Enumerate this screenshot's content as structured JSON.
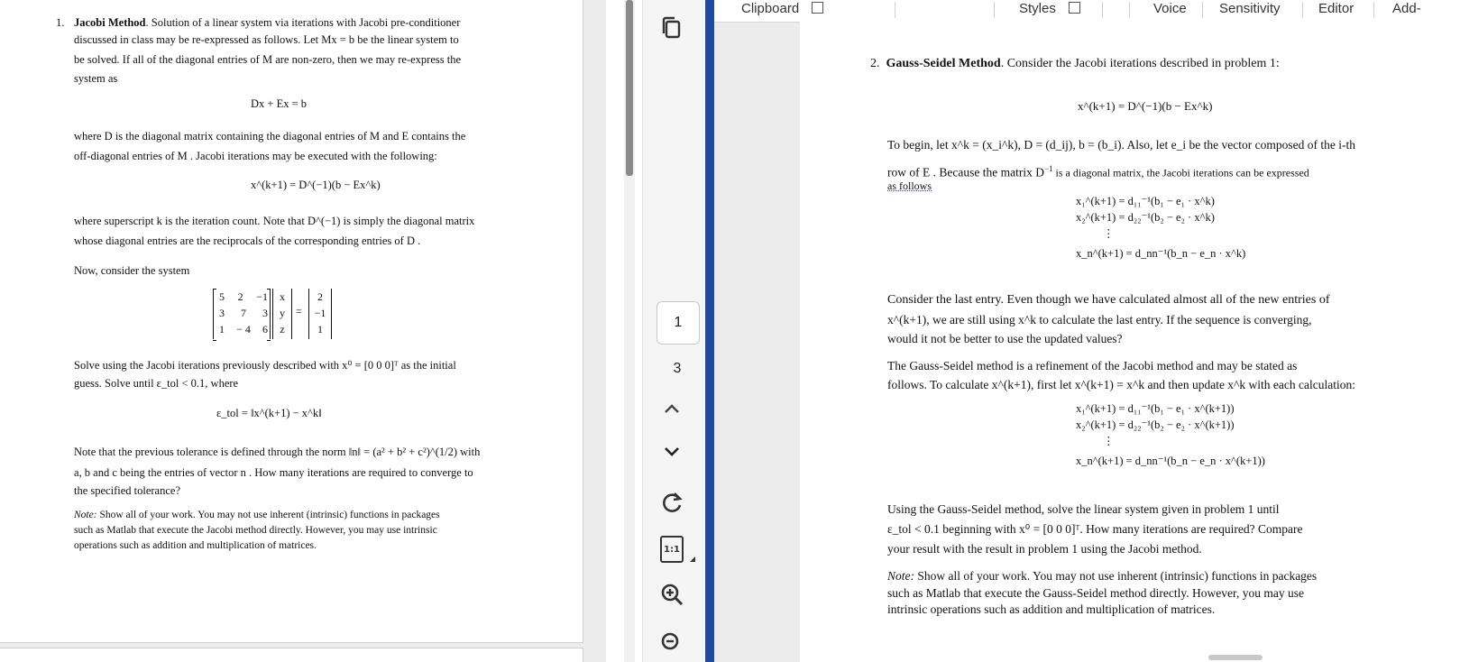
{
  "left_doc": {
    "p1_num": "1.",
    "p1_title": "Jacobi Method",
    "p1_line1": ". Solution of a linear system via iterations with Jacobi pre-conditioner",
    "p1_line2": "discussed in class may be re-expressed as follows. Let  Mx = b  be the linear system to",
    "p1_line3": "be solved. If all of the diagonal entries of  M  are non-zero, then we may re-express the",
    "p1_line4": "system as",
    "eq1": "Dx + Ex = b",
    "p2_line1": "where  D  is the diagonal matrix containing the diagonal entries of  M  and  E contains the",
    "p2_line2": "off-diagonal entries of  M . Jacobi iterations may be executed with the following:",
    "eq2": "x^(k+1) = D^(−1)(b − Ex^k)",
    "p3_line1": "where superscript k is the iteration count. Note that  D^(−1)  is simply the diagonal matrix",
    "p3_line2": "whose diagonal entries are the reciprocals of the corresponding entries of  D .",
    "p4": "Now, consider the system",
    "matrix_rows": [
      [
        "5",
        "2",
        "−1"
      ],
      [
        "3",
        "7",
        "3"
      ],
      [
        "1",
        "− 4",
        "6"
      ]
    ],
    "vector_x": [
      "x",
      "y",
      "z"
    ],
    "vector_b": [
      "2",
      "−1",
      "1"
    ],
    "p5_line1": "Solve using the Jacobi iterations previously described with  x⁰ = [0  0  0]ᵀ  as the initial",
    "p5_line2": "guess. Solve until  ε_tol < 0.1, where",
    "eq3": "ε_tol = ‖x^(k+1) − x^k‖",
    "p6_line1": "Note that the previous tolerance is defined through the norm  ‖n‖ = (a² + b² + c²)^(1/2)  with",
    "p6_line2": "a, b and c being the entries of vector  n . How many iterations are required to converge to",
    "p6_line3": "the specified tolerance?",
    "note_label": "Note:",
    "note_line1": " Show all of your work. You may not use inherent (intrinsic) functions in packages",
    "note_line2": "such as Matlab that execute the Jacobi method directly. However, you may use intrinsic",
    "note_line3": "operations such as addition and multiplication of matrices."
  },
  "toolbar": {
    "current_page": "1",
    "total_pages": "3",
    "icons": [
      "copy-icon",
      "chevron-up-icon",
      "chevron-down-icon",
      "refresh-icon",
      "actual-size-icon",
      "zoom-in-icon",
      "zoom-out-icon"
    ],
    "actual_size_label": "1:1"
  },
  "ribbon": {
    "clipboard": "Clipboard",
    "styles": "Styles",
    "voice": "Voice",
    "sensitivity": "Sensitivity",
    "editor": "Editor",
    "addins": "Add-"
  },
  "right_doc": {
    "q2_num": "2.",
    "q2_title": "Gauss-Seidel Method",
    "q2_intro": ". Consider the Jacobi iterations described in problem 1:",
    "eq1": "x^(k+1) = D^(−1)(b − Ex^k)",
    "p1_line1": "To begin, let  x^k = (x_i^k),  D = (d_ij),  b = (b_i). Also, let  e_i  be the vector composed of the i-th",
    "p1_line2a": "row of  E . Because the matrix  D",
    "p1_line2b": " is a diagonal matrix, the Jacobi iterations can be expressed",
    "p1_line3": "as follows",
    "jac_eqs": [
      "x₁^(k+1) = d₁₁⁻¹(b₁ − e₁ · x^k)",
      "x₂^(k+1) = d₂₂⁻¹(b₂ − e₂ · x^k)",
      "⋮",
      "x_n^(k+1) = d_nn⁻¹(b_n − e_n · x^k)"
    ],
    "p2_line1": "Consider the last entry. Even though we have calculated almost all of the new entries of",
    "p2_line2": "x^(k+1), we are still using  x^k  to calculate the last entry. If the sequence is converging,",
    "p2_line3": "would it not be better to use the updated values?",
    "p3_line1": "The Gauss-Seidel method is a refinement of the Jacobi method and may be stated as",
    "p3_line2": "follows.  To calculate  x^(k+1), first let  x^(k+1) = x^k  and then update  x^k with each calculation:",
    "gs_eqs": [
      "x₁^(k+1) = d₁₁⁻¹(b₁ − e₁ · x^(k+1))",
      "x₂^(k+1) = d₂₂⁻¹(b₂ − e₂ · x^(k+1))",
      "⋮",
      "x_n^(k+1) = d_nn⁻¹(b_n − e_n · x^(k+1))"
    ],
    "p4_line1": "Using the Gauss-Seidel method, solve the linear system given in problem 1 until",
    "p4_line2": "ε_tol < 0.1 beginning with  x⁰ = [0  0  0]ᵀ. How many iterations are required? Compare",
    "p4_line3": "your result with the result in problem 1 using the Jacobi method.",
    "note_label": "Note:",
    "note_line1": " Show all of your work. You may not use inherent (intrinsic) functions in packages",
    "note_line2": "such as Matlab that execute the Gauss-Seidel method directly. However, you may use",
    "note_line3": "intrinsic operations such as addition and multiplication of matrices."
  }
}
